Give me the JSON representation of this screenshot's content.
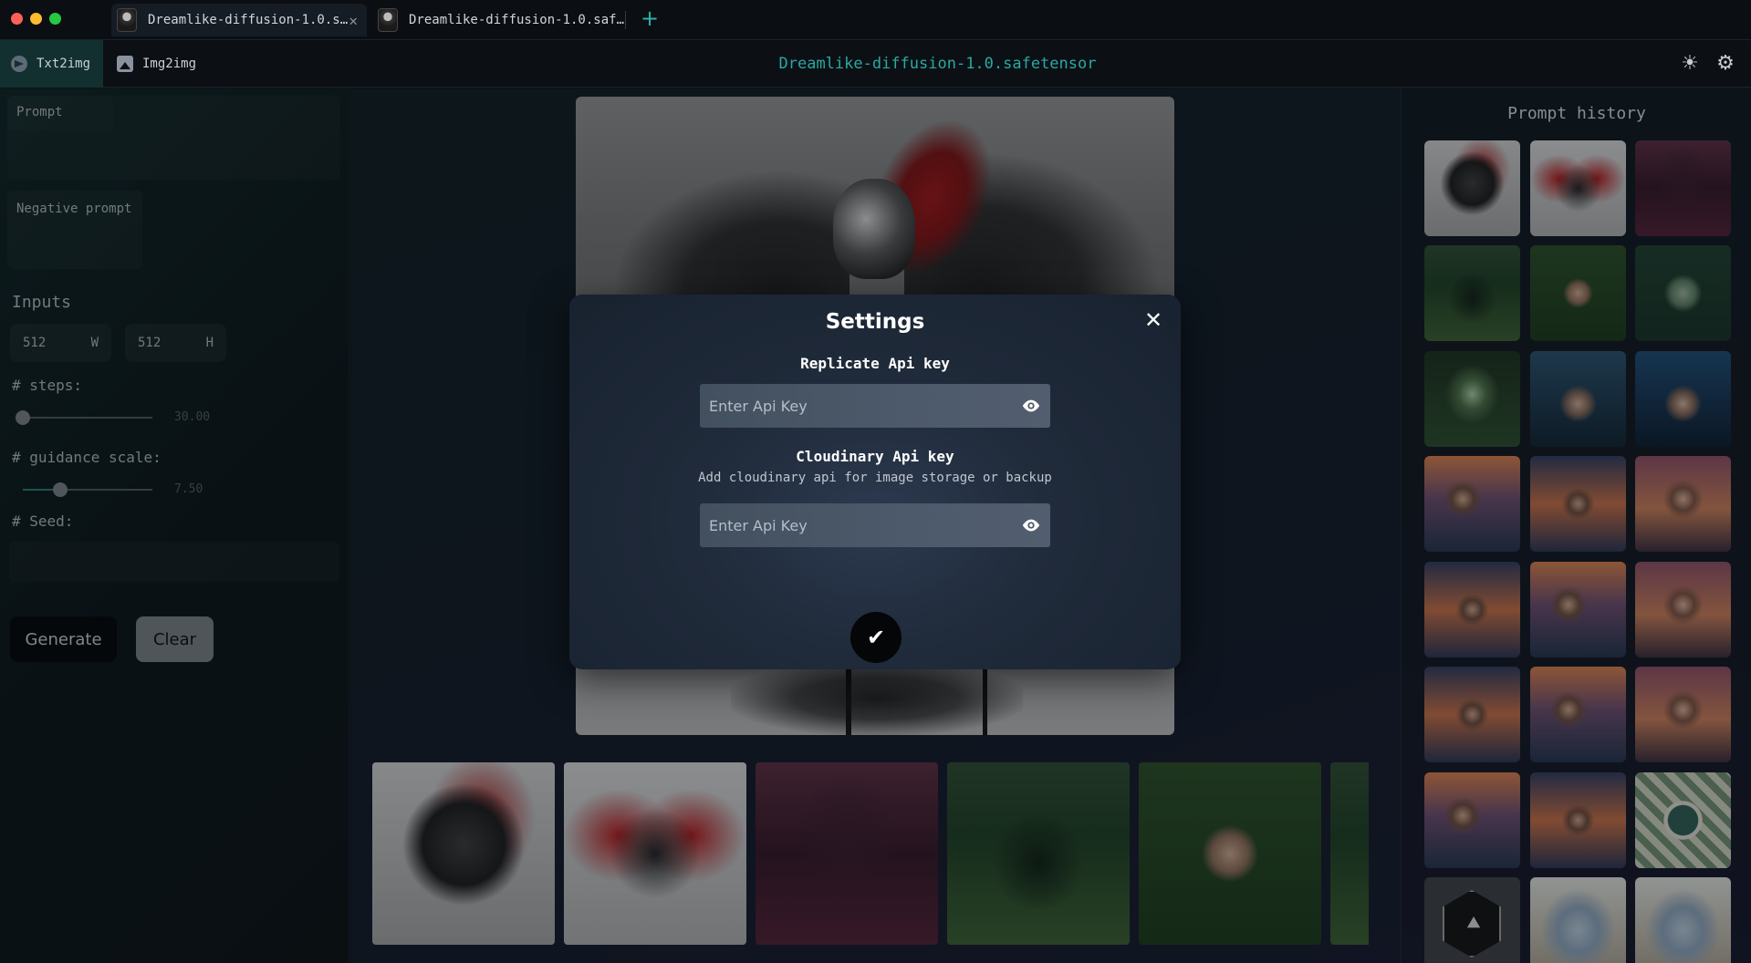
{
  "window": {
    "tabs": [
      {
        "label": "Dreamlike-diffusion-1.0.s…",
        "active": true
      },
      {
        "label": "Dreamlike-diffusion-1.0.saf…",
        "active": false
      }
    ],
    "add_tab_icon": "plus-icon"
  },
  "header": {
    "modes": [
      {
        "label": "Txt2img",
        "icon": "send-icon",
        "active": true
      },
      {
        "label": "Img2img",
        "icon": "image-icon",
        "active": false
      }
    ],
    "model_title": "Dreamlike-diffusion-1.0.safetensor",
    "icons": [
      "sun-icon",
      "gear-icon"
    ]
  },
  "sidebar": {
    "prompt_label": "Prompt",
    "negative_prompt_label": "Negative prompt",
    "inputs_title": "Inputs",
    "width": {
      "value": "512",
      "unit": "W"
    },
    "height": {
      "value": "512",
      "unit": "H"
    },
    "steps": {
      "label": "# steps:",
      "value": "30.00",
      "fraction": 0.0
    },
    "guidance": {
      "label": "# guidance scale:",
      "value": "7.50",
      "fraction": 0.29
    },
    "seed_label": "# Seed:",
    "generate_label": "Generate",
    "clear_label": "Clear"
  },
  "history": {
    "title": "Prompt history"
  },
  "modal": {
    "title": "Settings",
    "replicate_label": "Replicate Api key",
    "replicate_placeholder": "Enter Api Key",
    "cloudinary_label": "Cloudinary Api key",
    "cloudinary_sub": "Add cloudinary api for image storage or backup",
    "cloudinary_placeholder": "Enter Api Key",
    "close_icon": "close-icon",
    "confirm_icon": "check-icon"
  },
  "colors": {
    "accent": "#2aa9a0",
    "modal_bg": "#202b3b",
    "generate_bg": "#070809",
    "clear_bg": "#8d9297"
  }
}
